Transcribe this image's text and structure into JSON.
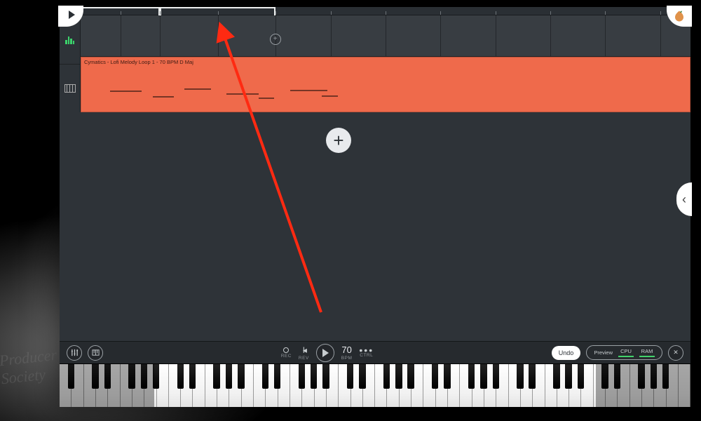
{
  "clip": {
    "title": "Cymatics - Lofi Melody Loop 1 - 70 BPM D Maj"
  },
  "transport": {
    "rec_label": "REC",
    "rev_label": "REV",
    "bpm_value": "70",
    "bpm_label": "BPM",
    "ctrl_label": "CTRL",
    "undo_label": "Undo",
    "preview_label": "Preview",
    "cpu_label": "CPU",
    "ram_label": "RAM"
  },
  "icons": {
    "play": "play",
    "plus": "+",
    "chevron_left": "‹",
    "logo": "fruit-logo",
    "mixer": "mixer",
    "pianoroll": "pianoroll",
    "close": "✕",
    "dots": "•••"
  },
  "colors": {
    "accent_clip": "#ef6a4b",
    "level_green": "#42d36b",
    "annotation": "#ff2a12"
  },
  "background_watermark": "Producer Society"
}
